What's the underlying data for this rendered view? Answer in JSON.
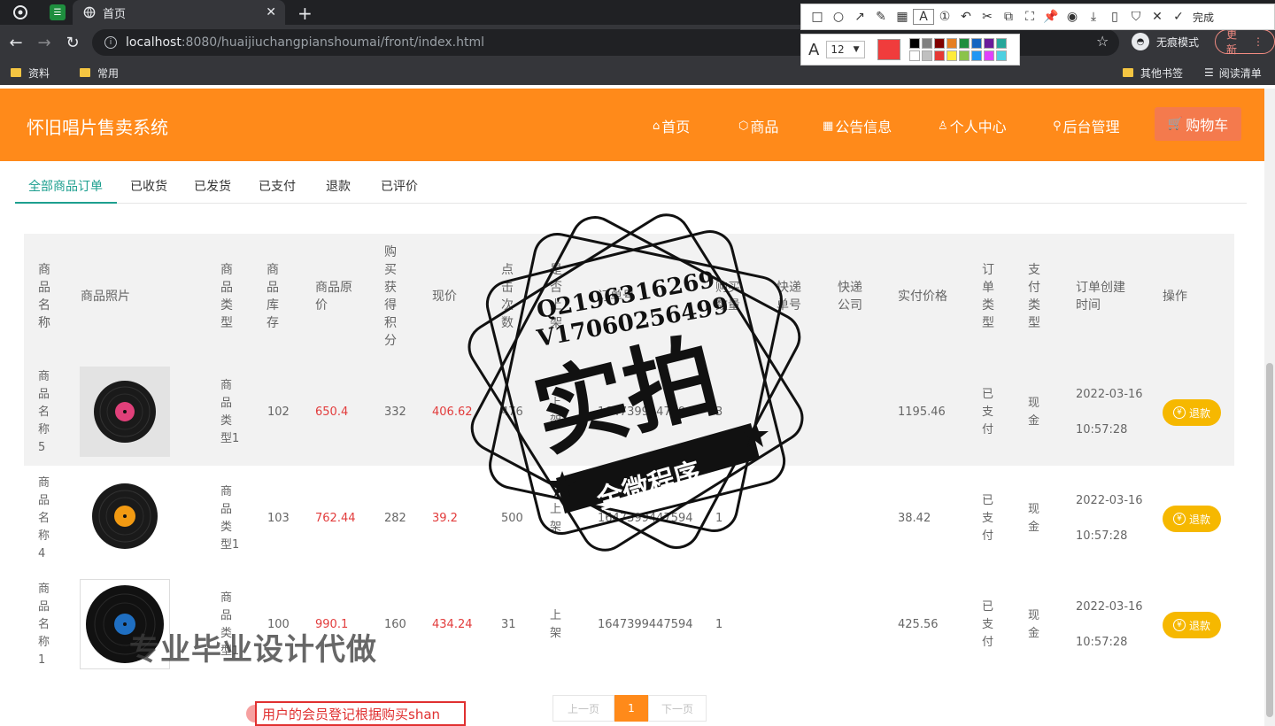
{
  "browser": {
    "tab_title": "首页",
    "url_host": "localhost",
    "url_path": ":8080/huaijiuchangpianshoumai/front/index.html",
    "incognito_label": "无痕模式",
    "update_label": "更新",
    "bookmarks": [
      "资料",
      "常用"
    ],
    "other_bookmarks": "其他书签",
    "reading_list": "阅读清单"
  },
  "annotation_tool": {
    "done_label": "完成",
    "font_size": "12",
    "palette": [
      "#000000",
      "#808080",
      "#800000",
      "#e67e22",
      "#1e8e3e",
      "#1565c0",
      "#6a1b9a",
      "#26a69a",
      "#ffffff",
      "#c0c0c0",
      "#e53935",
      "#ffeb3b",
      "#8bc34a",
      "#2196f3",
      "#e040fb",
      "#4dd0e1"
    ],
    "current_color": "#f03c3c"
  },
  "site": {
    "title": "怀旧唱片售卖系统",
    "nav": {
      "home": "首页",
      "goods": "商品",
      "notice": "公告信息",
      "personal": "个人中心",
      "admin": "后台管理",
      "cart": "购物车"
    },
    "accent": "#ff8a1a"
  },
  "tabs": [
    "全部商品订单",
    "已收货",
    "已发货",
    "已支付",
    "退款",
    "已评价"
  ],
  "table": {
    "headers": {
      "name": "商品名称",
      "photo": "商品照片",
      "type": "商品类型",
      "stock": "商品库存",
      "orig_price": "商品原价",
      "points": "购买获得积分",
      "price": "现价",
      "clicks": "点击次数",
      "shelf": "是否上架",
      "order_no": "订单号",
      "qty": "购买数量",
      "express_no": "快递单号",
      "express_co": "快递公司",
      "paid": "实付价格",
      "order_type": "订单类型",
      "pay_type": "支付类型",
      "created": "订单创建时间",
      "action": "操作"
    },
    "rows": [
      {
        "name": "商品名称5",
        "type": "商品类型1",
        "stock": "102",
        "orig_price": "650.4",
        "points": "332",
        "price": "406.62",
        "clicks": "476",
        "shelf": "上架",
        "order_no": "1647399447594",
        "qty": "3",
        "paid": "1195.46",
        "order_type": "已支付",
        "pay_type": "现金",
        "created_date": "2022-03-16",
        "created_time": "10:57:28",
        "action": "退款"
      },
      {
        "name": "商品名称4",
        "type": "商品类型1",
        "stock": "103",
        "orig_price": "762.44",
        "points": "282",
        "price": "39.2",
        "clicks": "500",
        "shelf": "上架",
        "order_no": "1647399447594",
        "qty": "1",
        "paid": "38.42",
        "order_type": "已支付",
        "pay_type": "现金",
        "created_date": "2022-03-16",
        "created_time": "10:57:28",
        "action": "退款"
      },
      {
        "name": "商品名称1",
        "type": "商品类型1",
        "stock": "100",
        "orig_price": "990.1",
        "points": "160",
        "price": "434.24",
        "clicks": "31",
        "shelf": "上架",
        "order_no": "1647399447594",
        "qty": "1",
        "paid": "425.56",
        "order_type": "已支付",
        "pay_type": "现金",
        "created_date": "2022-03-16",
        "created_time": "10:57:28",
        "action": "退款"
      }
    ]
  },
  "pagination": {
    "prev": "上一页",
    "current": "1",
    "next": "下一页"
  },
  "overlay": {
    "stamp_contact_q": "Q2196316269",
    "stamp_contact_v": "V17060256499",
    "stamp_main": "实拍",
    "stamp_banner": "全微程序",
    "watermark": "专业毕业设计代做",
    "caption": "用户的会员登记根据购买shan"
  }
}
